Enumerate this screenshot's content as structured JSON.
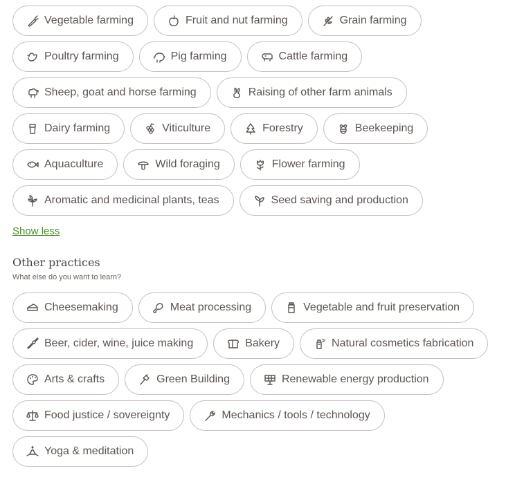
{
  "farming": [
    {
      "label": "Vegetable farming",
      "icon": "carrot-icon"
    },
    {
      "label": "Fruit and nut farming",
      "icon": "apple-icon"
    },
    {
      "label": "Grain farming",
      "icon": "wheat-icon"
    },
    {
      "label": "Poultry farming",
      "icon": "bird-icon"
    },
    {
      "label": "Pig farming",
      "icon": "piggy-icon"
    },
    {
      "label": "Cattle farming",
      "icon": "cow-icon"
    },
    {
      "label": "Sheep, goat and horse farming",
      "icon": "sheep-icon"
    },
    {
      "label": "Raising of other farm animals",
      "icon": "rabbit-icon"
    },
    {
      "label": "Dairy farming",
      "icon": "milk-glass-icon"
    },
    {
      "label": "Viticulture",
      "icon": "grapes-icon"
    },
    {
      "label": "Forestry",
      "icon": "tree-icon"
    },
    {
      "label": "Beekeeping",
      "icon": "bee-icon"
    },
    {
      "label": "Aquaculture",
      "icon": "fish-icon"
    },
    {
      "label": "Wild foraging",
      "icon": "mushroom-icon"
    },
    {
      "label": "Flower farming",
      "icon": "flower-icon"
    },
    {
      "label": "Aromatic and medicinal plants, teas",
      "icon": "herb-icon"
    },
    {
      "label": "Seed saving and production",
      "icon": "sprout-icon"
    }
  ],
  "show_less": "Show less",
  "other": {
    "title": "Other practices",
    "subtitle": "What else do you want to learn?",
    "items": [
      {
        "label": "Cheesemaking",
        "icon": "cheese-icon"
      },
      {
        "label": "Meat processing",
        "icon": "drumstick-icon"
      },
      {
        "label": "Vegetable and fruit preservation",
        "icon": "jar-icon"
      },
      {
        "label": "Beer, cider, wine, juice making",
        "icon": "bottle-icon"
      },
      {
        "label": "Bakery",
        "icon": "bread-icon"
      },
      {
        "label": "Natural cosmetics fabrication",
        "icon": "spray-bottle-icon"
      },
      {
        "label": "Arts & crafts",
        "icon": "palette-icon"
      },
      {
        "label": "Green Building",
        "icon": "hammer-icon"
      },
      {
        "label": "Renewable energy production",
        "icon": "solar-panel-icon"
      },
      {
        "label": "Food justice / sovereignty",
        "icon": "scales-icon"
      },
      {
        "label": "Mechanics / tools / technology",
        "icon": "wrench-icon"
      },
      {
        "label": "Yoga & meditation",
        "icon": "meditation-icon"
      }
    ]
  },
  "colors": {
    "accent_link": "#4d8a2e",
    "chip_border": "#c6bebb",
    "text": "#5c5451"
  }
}
